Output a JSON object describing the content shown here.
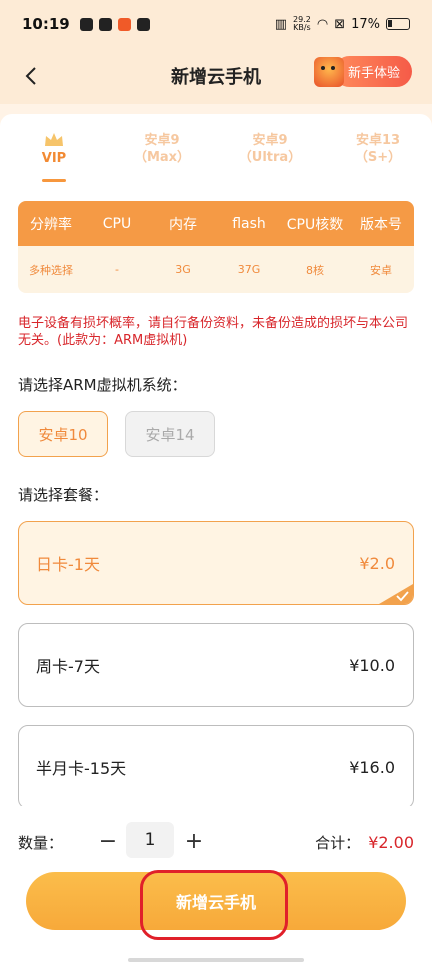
{
  "status_bar": {
    "time": "10:19",
    "speed_top": "29.2",
    "speed_bottom": "KB/s",
    "battery": "17%"
  },
  "header": {
    "title": "新增云手机",
    "newbie_label": "新手体验"
  },
  "tabs": [
    {
      "line1": "VIP",
      "line2": "",
      "active": true
    },
    {
      "line1": "安卓9",
      "line2": "（Max）",
      "active": false
    },
    {
      "line1": "安卓9",
      "line2": "（Ultra）",
      "active": false
    },
    {
      "line1": "安卓13",
      "line2": "（S+）",
      "active": false
    }
  ],
  "spec_table": {
    "headers": [
      "分辨率",
      "CPU",
      "内存",
      "flash",
      "CPU核数",
      "版本号"
    ],
    "values": [
      "多种选择",
      "-",
      "3G",
      "37G",
      "8核",
      "安卓"
    ]
  },
  "notice": "电子设备有损坏概率，请自行备份资料，未备份造成的损坏与本公司无关。(此款为：ARM虚拟机)",
  "os_section": {
    "label": "请选择ARM虚拟机系统：",
    "options": [
      {
        "label": "安卓10",
        "state": "selected"
      },
      {
        "label": "安卓14",
        "state": "disabled"
      }
    ]
  },
  "plan_section": {
    "label": "请选择套餐：",
    "plans": [
      {
        "name": "日卡-1天",
        "price": "¥2.0",
        "selected": true
      },
      {
        "name": "周卡-7天",
        "price": "¥10.0",
        "selected": false
      },
      {
        "name": "半月卡-15天",
        "price": "¥16.0",
        "selected": false
      }
    ]
  },
  "footer": {
    "qty_label": "数量：",
    "qty_minus": "−",
    "qty_value": "1",
    "qty_plus": "+",
    "total_label": "合计：",
    "total_amount": "¥2.00",
    "submit_label": "新增云手机"
  },
  "colors": {
    "accent": "#f7973d",
    "warning": "#d8262b"
  }
}
